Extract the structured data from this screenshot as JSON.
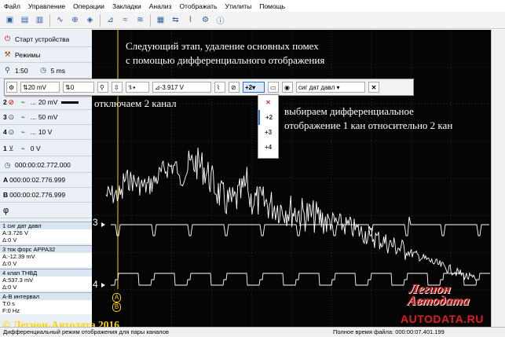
{
  "menu": [
    "Файл",
    "Управление",
    "Операции",
    "Закладки",
    "Анализ",
    "Отображать",
    "Утилиты",
    "Помощь"
  ],
  "sidebar": {
    "start_label": "Старт устройства",
    "modes_label": "Режимы",
    "p_label": "1:50",
    "time_label": "5 ms",
    "ch2": {
      "num": "2",
      "value": "20 mV"
    },
    "ch3": {
      "num": "3",
      "value": "50 mV"
    },
    "ch4": {
      "num": "4",
      "value": "10 V"
    },
    "trig": {
      "num": "1",
      "value": "0 V"
    },
    "cursor_t": "000:00:02.772.000",
    "cursor_a": "000:00:02.776.999",
    "cursor_b": "000:00:02.776.999",
    "phi": "φ",
    "panels": [
      {
        "h": "1 сиг дат давл",
        "v1": "A:3.726 V",
        "v2": "Δ:0 V"
      },
      {
        "h": "3 ток форс APPA32",
        "v1": "A:-12.39 mV",
        "v2": "Δ:0 V"
      },
      {
        "h": "4 клап ТНВД",
        "v1": "A:537.3 mV",
        "v2": "Δ:0 V"
      },
      {
        "h": "A-B интервал",
        "v1": "T:0 s",
        "v2": "F:0 Hz"
      }
    ]
  },
  "overlay_toolbar": {
    "range": "20 mV",
    "offset": "0",
    "level": "-3.917 V",
    "mode": "+2",
    "channel_name": "сиг дат давл"
  },
  "dropdown_items": [
    "+2",
    "+3",
    "+4"
  ],
  "annotations": {
    "title1": "Следующий этап, удаление основных помех",
    "title2": "с помощью дифференциального отображения",
    "ch2_off": "отключаем 2 канал",
    "diff1": "выбираем дифференциальное",
    "diff2": "отображение 1 кан относительно 2 кан"
  },
  "scope_labels": {
    "ch3": "3",
    "ch4": "4",
    "curA": "A",
    "curB": "B"
  },
  "copyright": "© Легион-Автодата 2016",
  "logo": {
    "line1": "Легион",
    "line2": "Автодата",
    "url": "AUTODATA.RU"
  },
  "status": {
    "left": "Дифференциальный режим отображения для пары каналов",
    "right": "Полное время файла: 000:00:07.401.199"
  },
  "chart_data": {
    "type": "line",
    "title": "",
    "xlabel": "",
    "ylabel": "",
    "grid": true,
    "series": [
      {
        "color": "#ffffff"
      },
      {
        "color": "#ffffff"
      },
      {
        "color": "#ffffff"
      }
    ]
  }
}
